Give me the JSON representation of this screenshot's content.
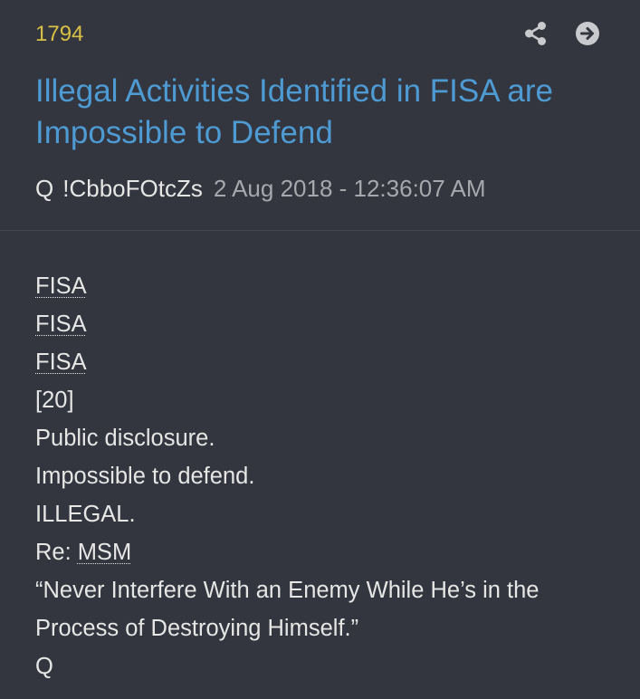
{
  "post": {
    "number": "1794",
    "title": "Illegal Activities Identified in FISA are Impossible to Defend",
    "author": "Q",
    "tripcode": "!CbboFOtcZs",
    "date": "2 Aug 2018 - 12:36:07 AM"
  },
  "actions": {
    "share_icon": "share-icon",
    "goto_icon": "arrow-right-circle-icon"
  },
  "body": {
    "fisa_1": "FISA",
    "fisa_2": "FISA",
    "fisa_3": "FISA",
    "count": "[20]",
    "line_public": "Public disclosure.",
    "line_impossible": "Impossible to defend.",
    "line_illegal": "ILLEGAL.",
    "re_prefix": "Re:",
    "re_target": "MSM",
    "quote_1": "“Never Interfere With an Enemy While He’s in the",
    "quote_2": "Process of Destroying Himself.”",
    "signature": "Q"
  },
  "colors": {
    "background": "#33363e",
    "number": "#d8c045",
    "title": "#4e9ad3",
    "text": "#e6e6e6",
    "muted": "#a6a8ad",
    "icon": "#c9cacd"
  }
}
